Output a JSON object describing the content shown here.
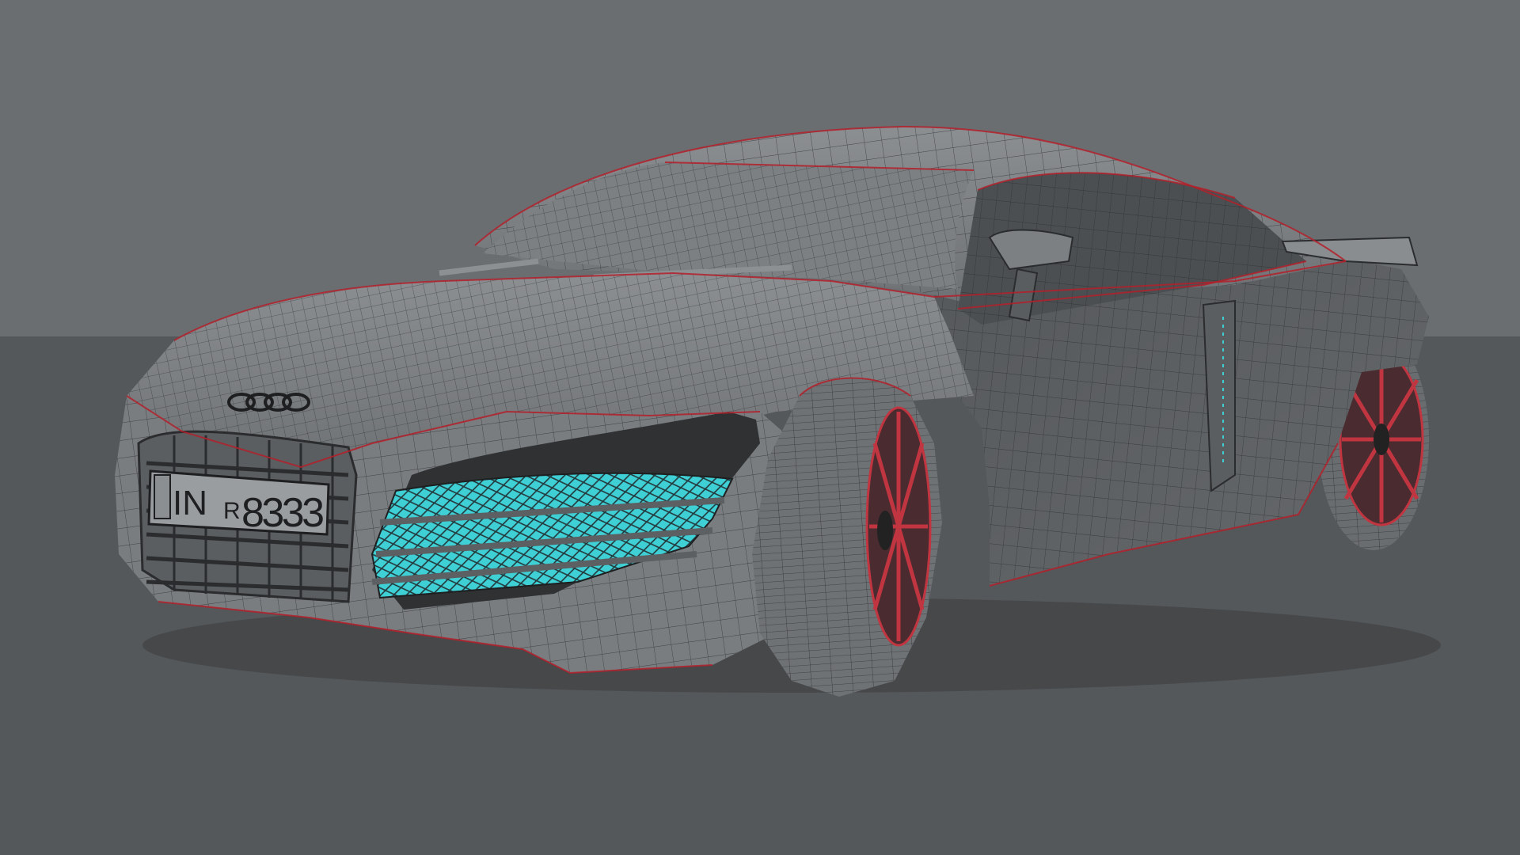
{
  "viewport": {
    "background_color": "#6b6e71",
    "ground_color": "#54575a",
    "wire_color": "#2a2c2e",
    "crease_color": "#b3202a",
    "selection_color": "#3fd0d6"
  },
  "model": {
    "brand_icon": "four-rings-icon",
    "plate": {
      "country": "IN",
      "letter": "R",
      "number": "8333"
    }
  }
}
